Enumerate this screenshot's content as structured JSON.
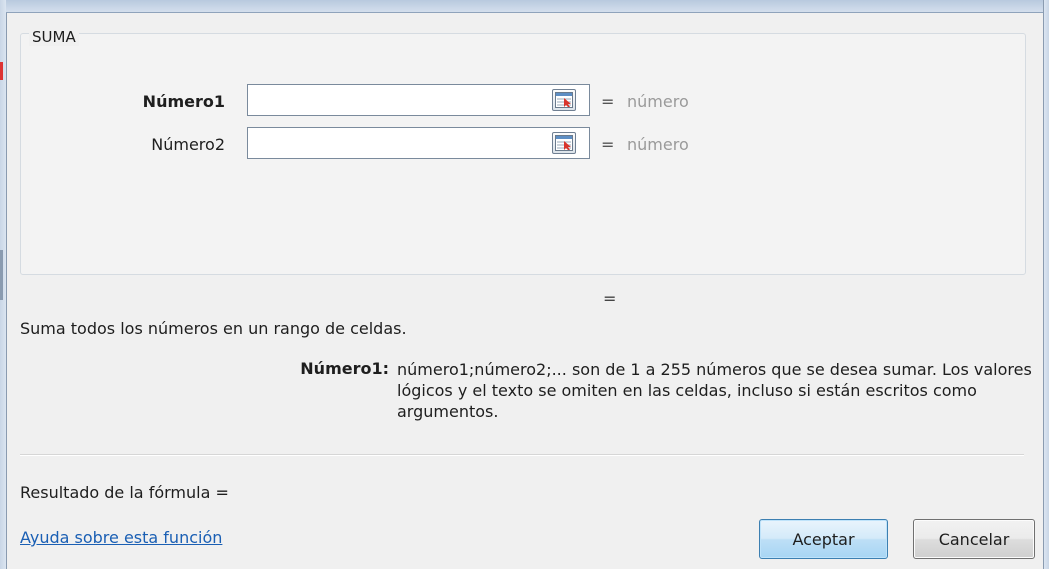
{
  "dialog": {
    "group_title": "SUMA",
    "arguments": [
      {
        "label": "Número1",
        "value": "",
        "equals": "=",
        "result": "número"
      },
      {
        "label": "Número2",
        "value": "",
        "equals": "=",
        "result": "número"
      }
    ],
    "total_equals": "=",
    "description": "Suma todos los números en un rango de celdas.",
    "arg_help_name": "Número1:",
    "arg_help_text": "número1;número2;... son de 1 a 255 números que se desea sumar. Los valores lógicos y el texto se omiten en las celdas, incluso si están escritos como argumentos.",
    "formula_result": "Resultado de la fórmula =",
    "help_link": "Ayuda sobre esta función",
    "ok_label": "Aceptar",
    "cancel_label": "Cancelar"
  },
  "icons": {
    "collapse_button": "collapse-dialog-icon"
  },
  "colors": {
    "link": "#1a5fb4",
    "hint": "#9a9a9a",
    "ok_border": "#3c7fb1"
  }
}
